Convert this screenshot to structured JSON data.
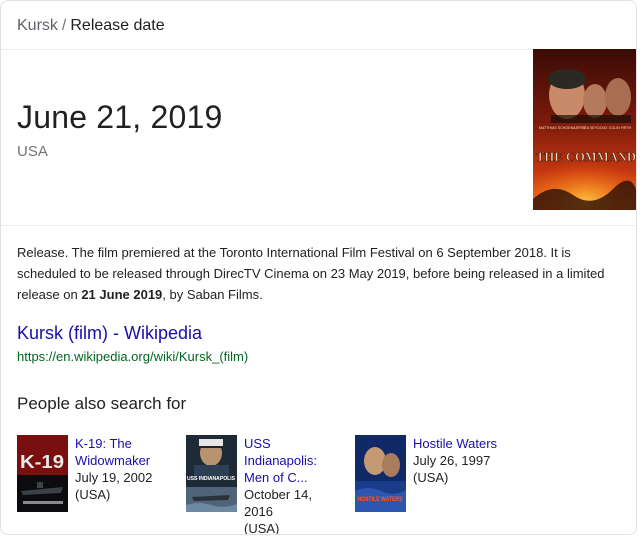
{
  "breadcrumb": {
    "parent": "Kursk",
    "separator": "/",
    "current": "Release date"
  },
  "answer": {
    "value": "June 21, 2019",
    "country": "USA"
  },
  "poster": {
    "names": [
      "MATTHIAS SCHOENAERTS",
      "LÉA SEYDOUX",
      "COLIN FIRTH"
    ],
    "title": "THE COMMAND"
  },
  "description": {
    "before": "Release. The film premiered at the Toronto International Film Festival on 6 September 2018. It is scheduled to be released through DirecTV Cinema on 23 May 2019, before being released in a limited release on ",
    "bold": "21 June 2019",
    "after": ", by Saban Films."
  },
  "source": {
    "title": "Kursk (film) - Wikipedia",
    "url": "https://en.wikipedia.org/wiki/Kursk_(film)"
  },
  "pasf": {
    "heading": "People also search for",
    "items": [
      {
        "title": "K-19: The Widowmaker",
        "date": "July 19, 2002",
        "country": "(USA)",
        "poster_text": "K-19"
      },
      {
        "title": "USS Indianapolis: Men of C...",
        "date": "October 14, 2016",
        "country": "(USA)",
        "poster_text": "USS INDIANAPOLIS"
      },
      {
        "title": "Hostile Waters",
        "date": "July 26, 1997",
        "country": "(USA)",
        "poster_text": "HOSTILE WATERS"
      }
    ]
  },
  "colors": {
    "link": "#1a0dab",
    "url": "#006621",
    "muted": "#70757a",
    "border": "#dfe1e5"
  }
}
